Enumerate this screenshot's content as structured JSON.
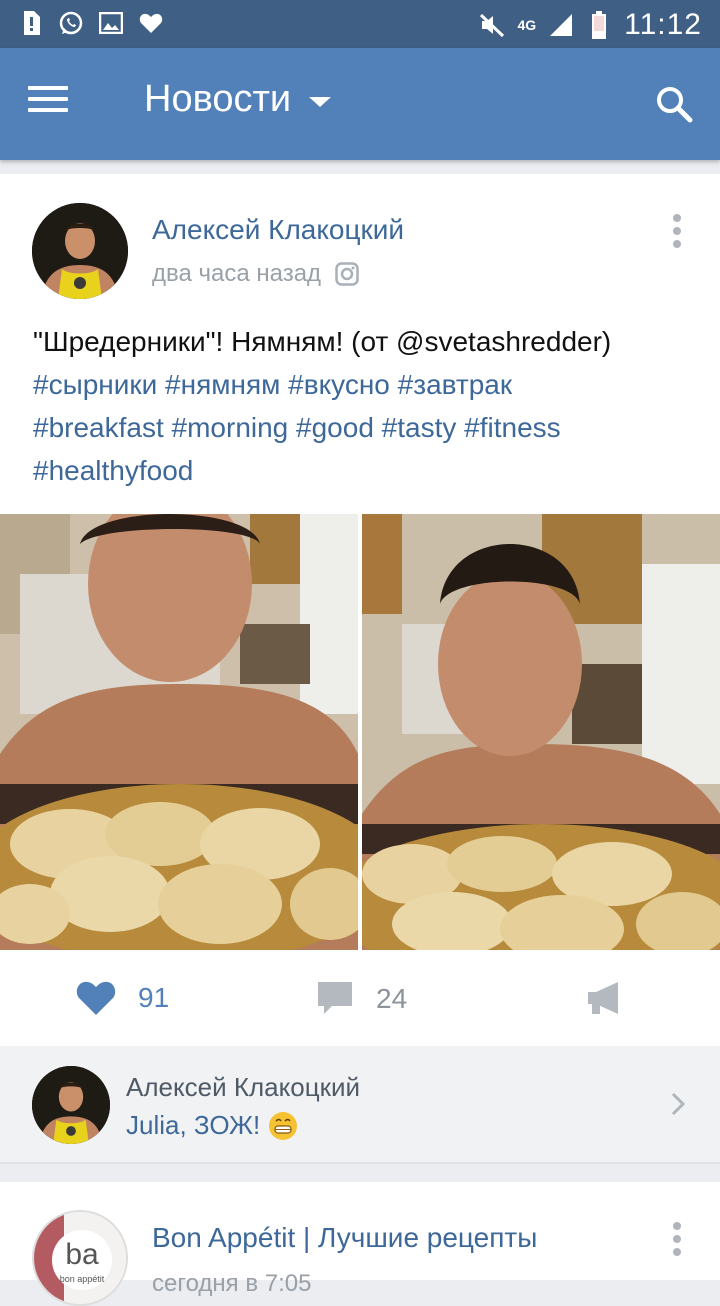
{
  "status_bar": {
    "time": "11:12",
    "network": "4G",
    "icons": [
      "sim-alert-icon",
      "whatsapp-icon",
      "gallery-icon",
      "heart-icon"
    ],
    "right_icons": [
      "mute-icon",
      "signal-icon",
      "battery-icon"
    ]
  },
  "toolbar": {
    "title": "Новости",
    "menu_icon": "hamburger-icon",
    "search_icon": "search-icon",
    "bg_color": "#5181b8"
  },
  "post1": {
    "author": "Алексей Клакоцкий",
    "time": "два часа назад",
    "source_icon": "instagram-icon",
    "text_plain": "\"Шредерники\"! Нямням! (от @svetashredder)",
    "tags_line1": "#сырники #нямням #вкусно #завтрак",
    "tags_line2": "#breakfast #morning #good #tasty #fitness",
    "tags_line3": "#healthyfood",
    "likes": "91",
    "comments": "24",
    "like_color": "#5181b8"
  },
  "comment": {
    "author": "Алексей Клакоцкий",
    "text": "Julia, ЗОЖ!",
    "emoji": "😁"
  },
  "post2": {
    "author": "Bon Appétit | Лучшие рецепты",
    "time": "сегодня в 7:05",
    "avatar_text": "ba",
    "avatar_subtext": "bon appétit"
  }
}
